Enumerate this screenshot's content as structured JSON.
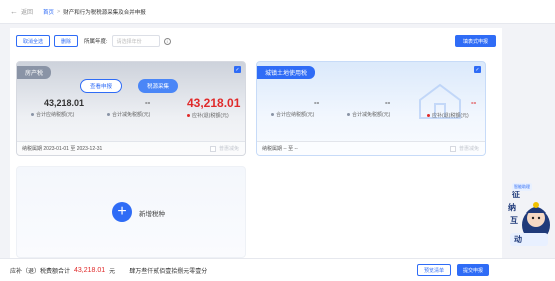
{
  "topbar": {
    "back_label": "返回",
    "breadcrumb_home": "首页",
    "breadcrumb_sep": ">",
    "breadcrumb_current": "财产和行为税税源采集及合并申报"
  },
  "toolbar": {
    "cancel_all_label": "取消全选",
    "delete_label": "删除",
    "period_label": "所属年度:",
    "period_placeholder": "请选择年份",
    "right_button_label": "填表式申报"
  },
  "cards": [
    {
      "tag": "房产税",
      "checked": true,
      "view_button": "查看申报",
      "collect_button": "税源采集",
      "should_pay_value": "43,218.01",
      "should_pay_label": "合计应纳税额(元)",
      "reduce_value": "--",
      "reduce_label": "合计减免税额(元)",
      "refund_value": "43,218.01",
      "refund_label": "应补(退)税额(元)",
      "period_text": "纳税属期 2023-01-01 至 2023-12-31",
      "footer_check_label": "普惠减免"
    },
    {
      "tag": "城镇土地使用税",
      "checked": true,
      "should_pay_value": "--",
      "should_pay_label": "合计应纳税额(元)",
      "reduce_value": "--",
      "reduce_label": "合计减免税额(元)",
      "refund_value": "--",
      "refund_label": "应补(退)税额(元)",
      "period_text": "纳税属期 -- 至 --",
      "footer_check_label": "普惠减免"
    }
  ],
  "add_card": {
    "label": "新增税种"
  },
  "bottombar": {
    "label": "应补（退）税费额合计",
    "amount": "43,218.01",
    "unit": "元",
    "amount_words": "肆万叁仟贰佰壹拾捌元零壹分",
    "preview_label": "预览清单",
    "submit_label": "提交申报"
  },
  "mascot": {
    "tag": "智能助理",
    "text1": "征",
    "text2": "纳",
    "text3": "互",
    "text4": "动"
  },
  "colors": {
    "primary": "#2f6cf6",
    "red": "#e02a2a"
  }
}
